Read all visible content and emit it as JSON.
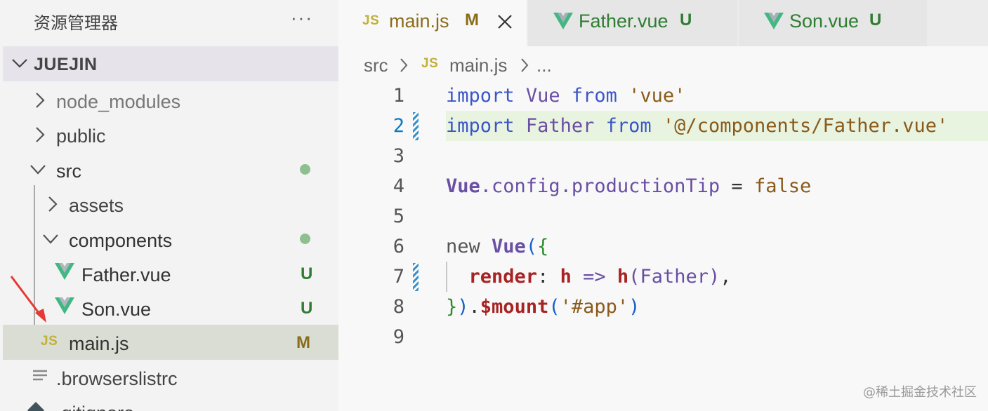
{
  "sidebar": {
    "title": "资源管理器",
    "more_label": "···",
    "root_label": "JUEJIN",
    "items": [
      {
        "label": "node_modules",
        "badge": ""
      },
      {
        "label": "public",
        "badge": ""
      },
      {
        "label": "src",
        "badge": ""
      },
      {
        "label": "assets",
        "badge": ""
      },
      {
        "label": "components",
        "badge": ""
      },
      {
        "label": "Father.vue",
        "badge": "U"
      },
      {
        "label": "Son.vue",
        "badge": "U"
      },
      {
        "label": "main.js",
        "badge": "M"
      },
      {
        "label": ".browserslistrc",
        "badge": ""
      },
      {
        "label": ".gitignore",
        "badge": ""
      }
    ]
  },
  "tabs": [
    {
      "label": "main.js",
      "badge": "M",
      "icon": "js-icon",
      "active": true
    },
    {
      "label": "Father.vue",
      "badge": "U",
      "icon": "vue-icon",
      "active": false
    },
    {
      "label": "Son.vue",
      "badge": "U",
      "icon": "vue-icon",
      "active": false
    }
  ],
  "breadcrumb": {
    "folder": "src",
    "file": "main.js",
    "more": "..."
  },
  "editor": {
    "line_numbers": [
      "1",
      "2",
      "3",
      "4",
      "5",
      "6",
      "7",
      "8",
      "9"
    ],
    "lines": {
      "l1": {
        "t1": "import",
        "t2": "Vue",
        "t3": "from",
        "t4": "'vue'"
      },
      "l2": {
        "t1": "import",
        "t2": "Father",
        "t3": "from",
        "t4": "'@/components/Father.vue'"
      },
      "l4": {
        "t1": "Vue",
        "t2": ".config.productionTip",
        "t3": "=",
        "t4": "false"
      },
      "l6": {
        "t1": "new",
        "t2": "Vue",
        "t3": "(",
        "t4": "{"
      },
      "l7": {
        "t1": "render",
        "t2": ":",
        "t3": "h",
        "t4": "=>",
        "t5": "h",
        "t6": "(",
        "t7": "Father",
        "t8": ")",
        "t9": ","
      },
      "l8": {
        "t1": "}",
        "t2": ")",
        "t3": ".",
        "t4": "$mount",
        "t5": "(",
        "t6": "'#app'",
        "t7": ")"
      }
    }
  },
  "watermark": "@稀土掘金技术社区",
  "colors": {
    "accent_js": "#c1b13b",
    "vue_green": "#41b883",
    "untracked": "#2e7d32",
    "modified": "#8a6d1c"
  }
}
